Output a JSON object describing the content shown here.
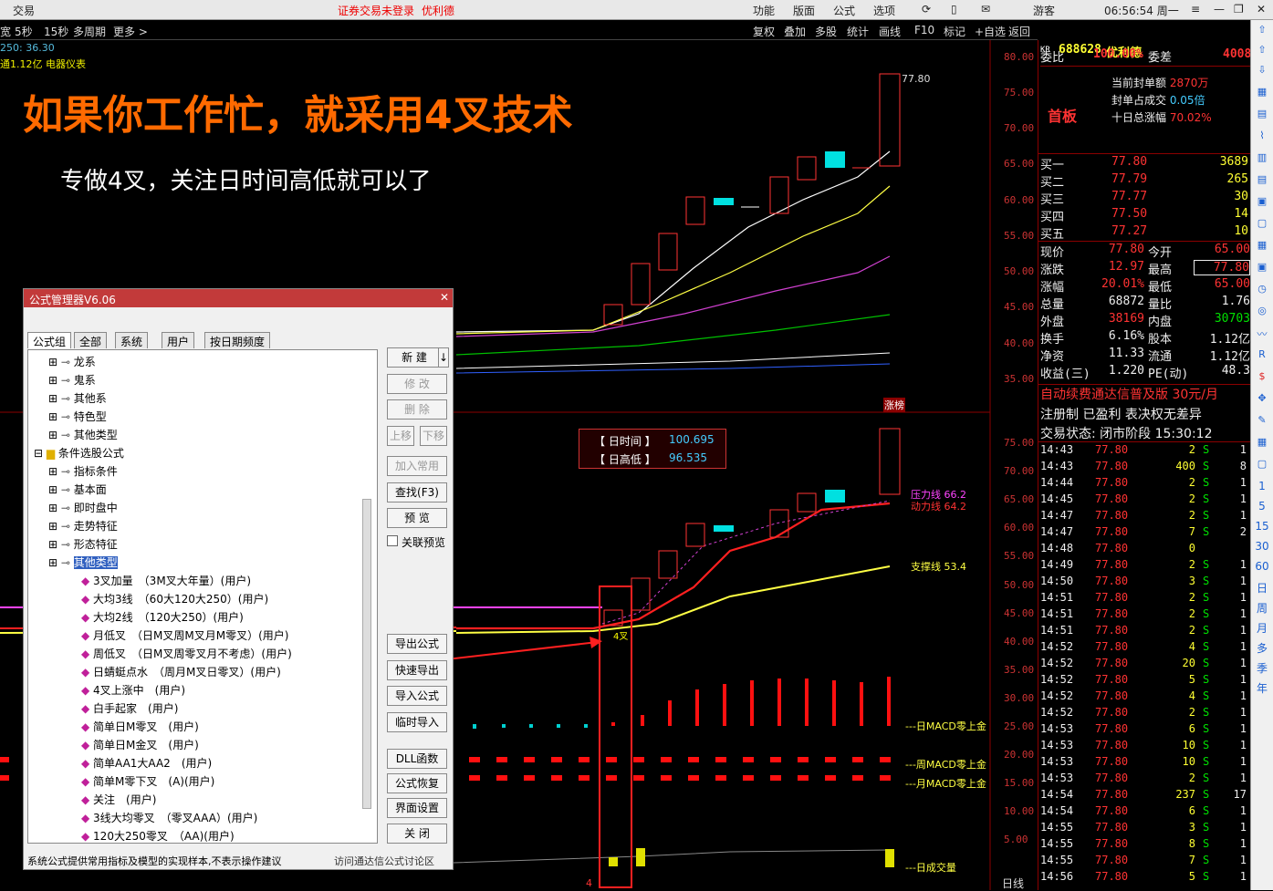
{
  "titlebar": {
    "app": "交易",
    "notice": "证券交易未登录",
    "stock_name": "优利德",
    "menus": [
      "功能",
      "版面",
      "公式",
      "选项"
    ],
    "user": "游客",
    "clock": "06:56:54 周一"
  },
  "toolbar": {
    "periods": [
      "5秒",
      "15秒",
      "多周期",
      "更多 >"
    ],
    "tools": [
      "复权",
      "叠加",
      "多股",
      "统计",
      "画线",
      "F10",
      "标记",
      "+自选",
      "返回"
    ]
  },
  "chart_info": {
    "ma_line": "250: 36.30",
    "sector": "通1.12亿 电器仪表",
    "max_label": "77.80",
    "zt_label": "涨榜",
    "four_cross": "4叉",
    "bottom_label": "日线",
    "bottom_tick": "4"
  },
  "headline": "如果你工作忙，就采用4叉技术",
  "subline": "专做4叉，关注日时间高低就可以了",
  "price_axis": [
    "80.00",
    "75.00",
    "70.00",
    "65.00",
    "60.00",
    "55.00",
    "50.00",
    "45.00",
    "40.00",
    "35.00"
  ],
  "lower_axis": [
    "75.00",
    "70.00",
    "65.00",
    "60.00",
    "55.00",
    "50.00",
    "45.00",
    "40.00",
    "35.00",
    "30.00",
    "25.00",
    "20.00",
    "15.00",
    "10.00",
    "5.00"
  ],
  "lines": {
    "pressure": "压力线 66.2",
    "power": "动力线 64.2",
    "support": "支撑线 53.4",
    "macd_d": "---日MACD零上金",
    "macd_w": "---周MACD零上金",
    "macd_m": "---月MACD零上金",
    "vol": "---日成交量"
  },
  "infobox": {
    "t1": "【 日时间 】",
    "v1": "100.695",
    "t2": "【 日高低 】",
    "v2": "96.535"
  },
  "dialog": {
    "title": "公式管理器V6.06",
    "tabs": [
      "公式组",
      "全部",
      "系统",
      "用户",
      "按日期频度"
    ],
    "tree": [
      "龙系",
      "鬼系",
      "其他系",
      "特色型",
      "其他类型",
      "条件选股公式",
      "指标条件",
      "基本面",
      "即时盘中",
      "走势特征",
      "形态特征",
      "其他类型"
    ],
    "items": [
      "3叉加量　（3M叉大年量）(用户)",
      "大均3线　（60大120大250）(用户)",
      "大均2线　（120大250）(用户)",
      "月低叉　（日M叉周M叉月M零叉）(用户)",
      "周低叉　（日M叉周零叉月不考虑）(用户)",
      "日蜻蜓点水　（周月M叉日零叉）(用户)",
      "4叉上涨中　(用户)",
      "白手起家　(用户)",
      "简单日M零叉　(用户)",
      "简单日M金叉　(用户)",
      "简单AA1大AA2　(用户)",
      "简单M零下叉　(A)(用户)",
      "关注　(用户)",
      "3线大均零叉　（零叉AAA）(用户)",
      "120大250零叉　（AA)(用户)"
    ],
    "buttons": [
      "新 建",
      "修 改",
      "删 除",
      "上移",
      "下移",
      "加入常用",
      "查找(F3)",
      "预 览",
      "导出公式",
      "快速导出",
      "导入公式",
      "临时导入",
      "DLL函数",
      "公式恢复",
      "界面设置",
      "关 闭"
    ],
    "preview_label": "关联预览",
    "status_left": "系统公式提供常用指标及模型的实现样本,不表示操作建议",
    "status_right": "访问通达信公式讨论区"
  },
  "quote": {
    "code": "688628",
    "name": "优利德",
    "tag": "KR",
    "wb": "委比",
    "wb_v": "100.00%",
    "wc": "委差",
    "wc_v": "4008",
    "board": "首板",
    "seal_l1": "当前封单额",
    "seal_v1": "2870万",
    "seal_l2": "封单占成交",
    "seal_v2": "0.05倍",
    "seal_l3": "十日总涨幅",
    "seal_v3": "70.02%",
    "bids": [
      [
        "买一",
        "77.80",
        "3689"
      ],
      [
        "买二",
        "77.79",
        "265"
      ],
      [
        "买三",
        "77.77",
        "30"
      ],
      [
        "买四",
        "77.50",
        "14"
      ],
      [
        "买五",
        "77.27",
        "10"
      ]
    ],
    "stats": [
      [
        "现价",
        "77.80",
        "今开",
        "65.00"
      ],
      [
        "涨跌",
        "12.97",
        "最高",
        "77.80"
      ],
      [
        "涨幅",
        "20.01%",
        "最低",
        "65.00"
      ],
      [
        "总量",
        "68872",
        "量比",
        "1.76"
      ],
      [
        "外盘",
        "38169",
        "内盘",
        "30703"
      ],
      [
        "换手",
        "6.16%",
        "股本",
        "1.12亿"
      ],
      [
        "净资",
        "11.33",
        "流通",
        "1.12亿"
      ],
      [
        "收益(三)",
        "1.220",
        "PE(动)",
        "48.3"
      ]
    ],
    "ad1": "自动续费通达信普及版 30元/月",
    "ad2": "注册制 已盈利 表决权无差异",
    "state": "交易状态: 闭市阶段 15:30:12"
  },
  "ticks": [
    [
      "14:43",
      "77.80",
      "2",
      "S",
      "1"
    ],
    [
      "14:43",
      "77.80",
      "400",
      "S",
      "8"
    ],
    [
      "14:44",
      "77.80",
      "2",
      "S",
      "1"
    ],
    [
      "14:45",
      "77.80",
      "2",
      "S",
      "1"
    ],
    [
      "14:47",
      "77.80",
      "2",
      "S",
      "1"
    ],
    [
      "14:47",
      "77.80",
      "7",
      "S",
      "2"
    ],
    [
      "14:48",
      "77.80",
      "0",
      "",
      ""
    ],
    [
      "14:49",
      "77.80",
      "2",
      "S",
      "1"
    ],
    [
      "14:50",
      "77.80",
      "3",
      "S",
      "1"
    ],
    [
      "14:51",
      "77.80",
      "2",
      "S",
      "1"
    ],
    [
      "14:51",
      "77.80",
      "2",
      "S",
      "1"
    ],
    [
      "14:51",
      "77.80",
      "2",
      "S",
      "1"
    ],
    [
      "14:52",
      "77.80",
      "4",
      "S",
      "1"
    ],
    [
      "14:52",
      "77.80",
      "20",
      "S",
      "1"
    ],
    [
      "14:52",
      "77.80",
      "5",
      "S",
      "1"
    ],
    [
      "14:52",
      "77.80",
      "4",
      "S",
      "1"
    ],
    [
      "14:52",
      "77.80",
      "2",
      "S",
      "1"
    ],
    [
      "14:53",
      "77.80",
      "6",
      "S",
      "1"
    ],
    [
      "14:53",
      "77.80",
      "10",
      "S",
      "1"
    ],
    [
      "14:53",
      "77.80",
      "10",
      "S",
      "1"
    ],
    [
      "14:53",
      "77.80",
      "2",
      "S",
      "1"
    ],
    [
      "14:54",
      "77.80",
      "237",
      "S",
      "17"
    ],
    [
      "14:54",
      "77.80",
      "6",
      "S",
      "1"
    ],
    [
      "14:55",
      "77.80",
      "3",
      "S",
      "1"
    ],
    [
      "14:55",
      "77.80",
      "8",
      "S",
      "1"
    ],
    [
      "14:55",
      "77.80",
      "7",
      "S",
      "1"
    ],
    [
      "14:56",
      "77.80",
      "5",
      "S",
      "1"
    ]
  ],
  "sidebar": [
    "日",
    "周",
    "月",
    "多",
    "季",
    "年",
    "1",
    "5",
    "15",
    "30",
    "60"
  ]
}
